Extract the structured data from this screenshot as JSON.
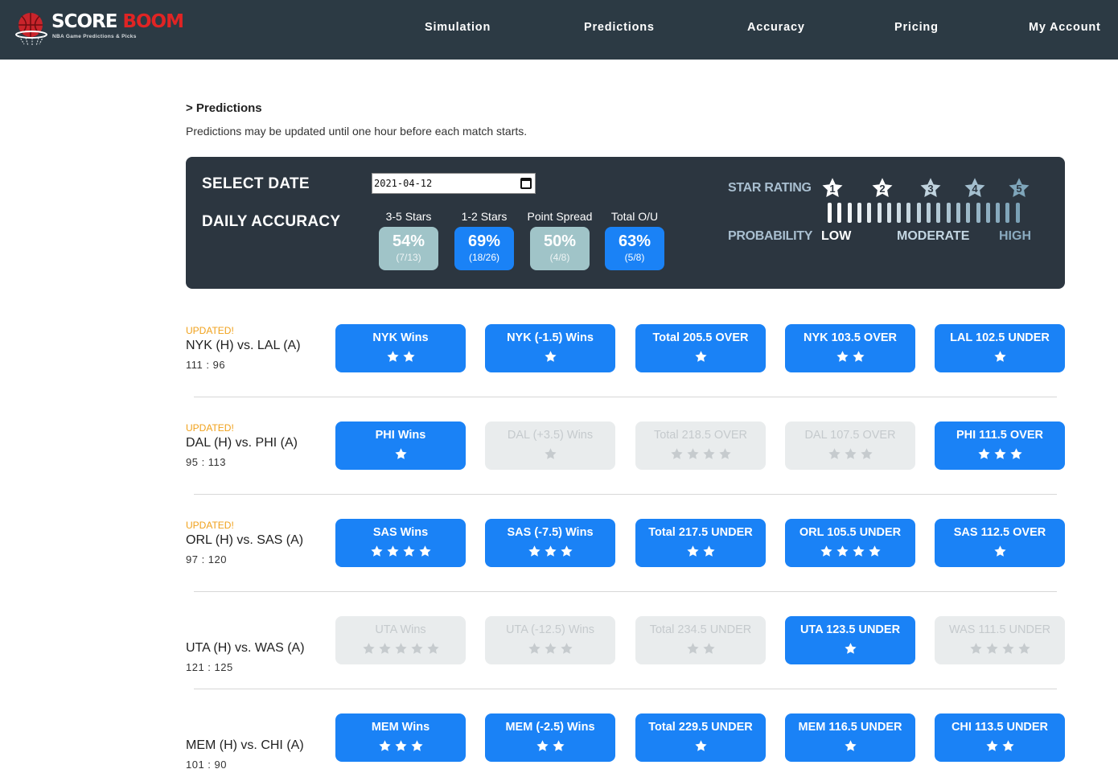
{
  "header": {
    "logo_word1": "SCORE",
    "logo_word2": "BOOM",
    "logo_tagline": "NBA Game Predictions & Picks",
    "nav": [
      "Simulation",
      "Predictions",
      "Accuracy",
      "Pricing",
      "My Account"
    ]
  },
  "page": {
    "breadcrumb": "> Predictions",
    "subtitle": "Predictions may be updated until one hour before each match starts."
  },
  "panel": {
    "select_date_label": "SELECT DATE",
    "date_value": "2021-04-12",
    "daily_accuracy_label": "DAILY ACCURACY",
    "accuracy": [
      {
        "label": "3-5 Stars",
        "pct": "54%",
        "frac": "(7/13)",
        "style": "gray"
      },
      {
        "label": "1-2 Stars",
        "pct": "69%",
        "frac": "(18/26)",
        "style": "blue"
      },
      {
        "label": "Point Spread",
        "pct": "50%",
        "frac": "(4/8)",
        "style": "gray"
      },
      {
        "label": "Total O/U",
        "pct": "63%",
        "frac": "(5/8)",
        "style": "blue"
      }
    ],
    "star_rating_label": "STAR RATING",
    "star_levels": [
      "1",
      "2",
      "3",
      "4",
      "5"
    ],
    "probability_label": "PROBABILITY",
    "prob_low": "LOW",
    "prob_moderate": "MODERATE",
    "prob_high": "HIGH"
  },
  "games": [
    {
      "updated": "UPDATED!",
      "matchup": "NYK (H) vs. LAL (A)",
      "score": "111 : 96",
      "picks": [
        {
          "label": "NYK Wins",
          "stars": 2,
          "active": true
        },
        {
          "label": "NYK (-1.5) Wins",
          "stars": 1,
          "active": true
        },
        {
          "label": "Total 205.5 OVER",
          "stars": 1,
          "active": true
        },
        {
          "label": "NYK 103.5 OVER",
          "stars": 2,
          "active": true
        },
        {
          "label": "LAL 102.5 UNDER",
          "stars": 1,
          "active": true
        }
      ]
    },
    {
      "updated": "UPDATED!",
      "matchup": "DAL (H) vs. PHI (A)",
      "score": "95 : 113",
      "picks": [
        {
          "label": "PHI Wins",
          "stars": 1,
          "active": true
        },
        {
          "label": "DAL (+3.5) Wins",
          "stars": 1,
          "active": false
        },
        {
          "label": "Total 218.5 OVER",
          "stars": 4,
          "active": false
        },
        {
          "label": "DAL 107.5 OVER",
          "stars": 3,
          "active": false
        },
        {
          "label": "PHI 111.5 OVER",
          "stars": 3,
          "active": true
        }
      ]
    },
    {
      "updated": "UPDATED!",
      "matchup": "ORL (H) vs. SAS (A)",
      "score": "97 : 120",
      "picks": [
        {
          "label": "SAS Wins",
          "stars": 4,
          "active": true
        },
        {
          "label": "SAS (-7.5) Wins",
          "stars": 3,
          "active": true
        },
        {
          "label": "Total 217.5 UNDER",
          "stars": 2,
          "active": true
        },
        {
          "label": "ORL 105.5 UNDER",
          "stars": 4,
          "active": true
        },
        {
          "label": "SAS 112.5 OVER",
          "stars": 1,
          "active": true
        }
      ]
    },
    {
      "updated": "",
      "matchup": "UTA (H) vs. WAS (A)",
      "score": "121 : 125",
      "picks": [
        {
          "label": "UTA Wins",
          "stars": 5,
          "active": false
        },
        {
          "label": "UTA (-12.5) Wins",
          "stars": 3,
          "active": false
        },
        {
          "label": "Total 234.5 UNDER",
          "stars": 2,
          "active": false
        },
        {
          "label": "UTA 123.5 UNDER",
          "stars": 1,
          "active": true
        },
        {
          "label": "WAS 111.5 UNDER",
          "stars": 4,
          "active": false
        }
      ]
    },
    {
      "updated": "",
      "matchup": "MEM (H) vs. CHI (A)",
      "score": "101 : 90",
      "picks": [
        {
          "label": "MEM Wins",
          "stars": 3,
          "active": true
        },
        {
          "label": "MEM (-2.5) Wins",
          "stars": 2,
          "active": true
        },
        {
          "label": "Total 229.5 UNDER",
          "stars": 1,
          "active": true
        },
        {
          "label": "MEM 116.5 UNDER",
          "stars": 1,
          "active": true
        },
        {
          "label": "CHI 113.5 UNDER",
          "stars": 2,
          "active": true
        }
      ]
    }
  ],
  "colors": {
    "header_bg": "#2c3a44",
    "panel_bg": "#2c3640",
    "accent_blue": "#1a82f6",
    "inactive_gray": "#e9eced",
    "updated_orange": "#f0a11b",
    "accuracy_gray": "#a0c4c8",
    "brand_red": "#e02424"
  }
}
